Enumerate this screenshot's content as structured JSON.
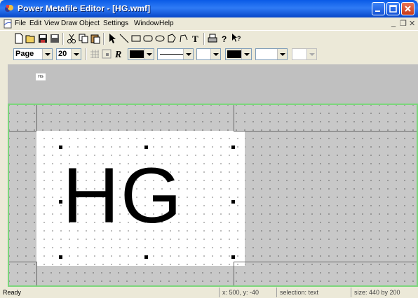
{
  "window": {
    "title": "Power Metafile Editor - [HG.wmf]"
  },
  "menu": {
    "items": [
      "File",
      "Edit",
      "View",
      "Draw",
      "Object",
      "Settings",
      "Window",
      "Help"
    ]
  },
  "toolbar": {
    "zoom_value": "Page",
    "size_value": "20",
    "bold_label": "R",
    "text_tool_label": "T"
  },
  "thumbnail": {
    "label": "HG"
  },
  "canvas": {
    "text": "HG"
  },
  "status": {
    "ready": "Ready",
    "coords": "x: 500, y: -40",
    "selection": "selection: text",
    "size": "size: 440 by 200"
  },
  "colors": {
    "titlebar": "#0a5be6",
    "canvas_border": "#7cd67c",
    "workspace": "#c8c8c8"
  }
}
